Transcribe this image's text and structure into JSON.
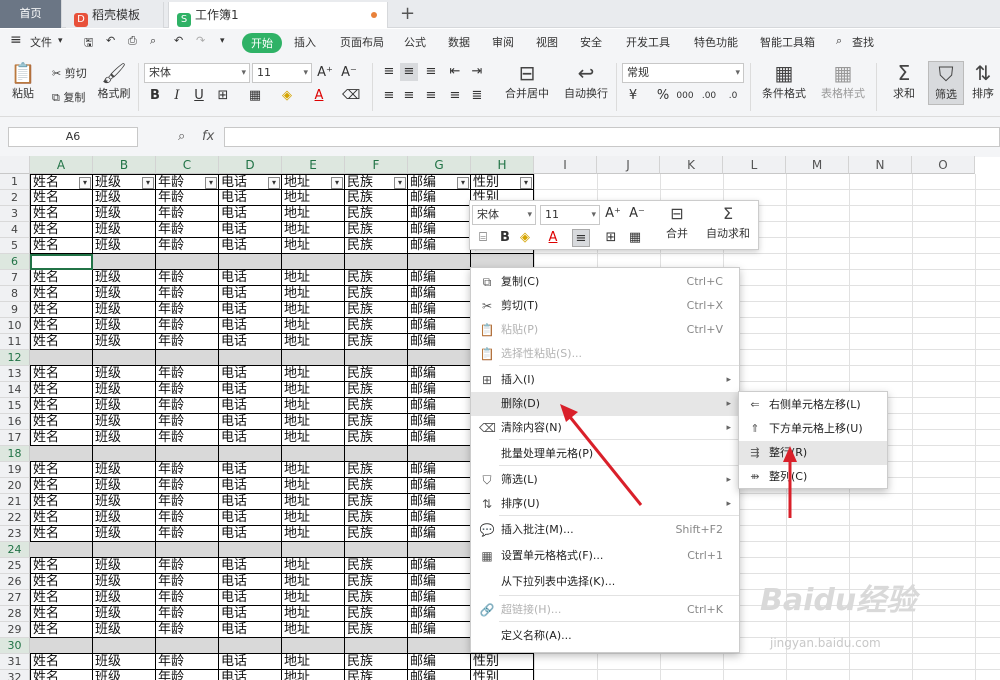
{
  "tabs": [
    {
      "label": "首页"
    },
    {
      "label": "稻壳模板"
    },
    {
      "label": "工作簿1"
    }
  ],
  "menu": {
    "file": "文件",
    "start": "开始",
    "items": [
      "插入",
      "页面布局",
      "公式",
      "数据",
      "审阅",
      "视图",
      "安全",
      "开发工具",
      "特色功能",
      "智能工具箱"
    ],
    "search": "查找"
  },
  "ribbon": {
    "paste": "粘贴",
    "cut": "剪切",
    "copy": "复制",
    "format_painter": "格式刷",
    "font": "宋体",
    "size": "11",
    "merge": "合并居中",
    "wrap": "自动换行",
    "numfmt": "常规",
    "cond": "条件格式",
    "table_style": "表格样式",
    "sum": "求和",
    "filter": "筛选",
    "sort": "排序"
  },
  "formula": {
    "namebox": "A6",
    "fx": "fx"
  },
  "columns": [
    "A",
    "B",
    "C",
    "D",
    "E",
    "F",
    "G",
    "H",
    "I",
    "J",
    "K",
    "L",
    "M",
    "N",
    "O"
  ],
  "header_row": [
    "姓名",
    "班级",
    "年龄",
    "电话",
    "地址",
    "民族",
    "邮编",
    "性别"
  ],
  "data_row": [
    "姓名",
    "班级",
    "年龄",
    "电话",
    "地址",
    "民族",
    "邮编",
    "性别"
  ],
  "gray_rows": [
    6,
    12,
    18,
    24,
    30
  ],
  "row_numbers": [
    "1",
    "2",
    "3",
    "4",
    "5",
    "6",
    "7",
    "8",
    "9",
    "10",
    "11",
    "12",
    "13",
    "14",
    "15",
    "16",
    "17",
    "18",
    "19",
    "20",
    "21",
    "22",
    "23",
    "24",
    "25",
    "26",
    "27",
    "28",
    "29",
    "30",
    "31",
    "32"
  ],
  "mini_toolbar": {
    "font": "宋体",
    "size": "11",
    "merge": "合并",
    "autosum": "自动求和"
  },
  "context_menu": [
    {
      "label": "复制(C)",
      "shortcut": "Ctrl+C",
      "icon": "copy-icon",
      "disabled": false
    },
    {
      "label": "剪切(T)",
      "shortcut": "Ctrl+X",
      "icon": "scissors-icon",
      "disabled": false
    },
    {
      "label": "粘贴(P)",
      "shortcut": "Ctrl+V",
      "icon": "paste-icon",
      "disabled": true
    },
    {
      "label": "选择性粘贴(S)...",
      "shortcut": "",
      "icon": "paste-special-icon",
      "disabled": true
    },
    {
      "label": "插入(I)",
      "shortcut": "",
      "icon": "insert-icon",
      "disabled": false
    },
    {
      "label": "删除(D)",
      "shortcut": "",
      "icon": "",
      "disabled": false
    },
    {
      "label": "清除内容(N)",
      "shortcut": "",
      "icon": "eraser-icon",
      "disabled": false
    },
    {
      "label": "批量处理单元格(P)",
      "shortcut": "",
      "icon": "",
      "disabled": false
    },
    {
      "label": "筛选(L)",
      "shortcut": "",
      "icon": "filter-icon",
      "disabled": false
    },
    {
      "label": "排序(U)",
      "shortcut": "",
      "icon": "sort-icon",
      "disabled": false
    },
    {
      "label": "插入批注(M)...",
      "shortcut": "Shift+F2",
      "icon": "comment-icon",
      "disabled": false
    },
    {
      "label": "设置单元格格式(F)...",
      "shortcut": "Ctrl+1",
      "icon": "format-cells-icon",
      "disabled": false
    },
    {
      "label": "从下拉列表中选择(K)...",
      "shortcut": "",
      "icon": "",
      "disabled": false
    },
    {
      "label": "超链接(H)...",
      "shortcut": "Ctrl+K",
      "icon": "link-icon",
      "disabled": true
    },
    {
      "label": "定义名称(A)...",
      "shortcut": "",
      "icon": "",
      "disabled": false
    }
  ],
  "submenu": [
    {
      "label": "右侧单元格左移(L)"
    },
    {
      "label": "下方单元格上移(U)"
    },
    {
      "label": "整行(R)"
    },
    {
      "label": "整列(C)"
    }
  ],
  "watermark": {
    "brand": "Baidu经验",
    "url": "jingyan.baidu.com"
  },
  "colors": {
    "accent": "#2fb266",
    "selection": "#217346",
    "arrow": "#d9202a"
  }
}
